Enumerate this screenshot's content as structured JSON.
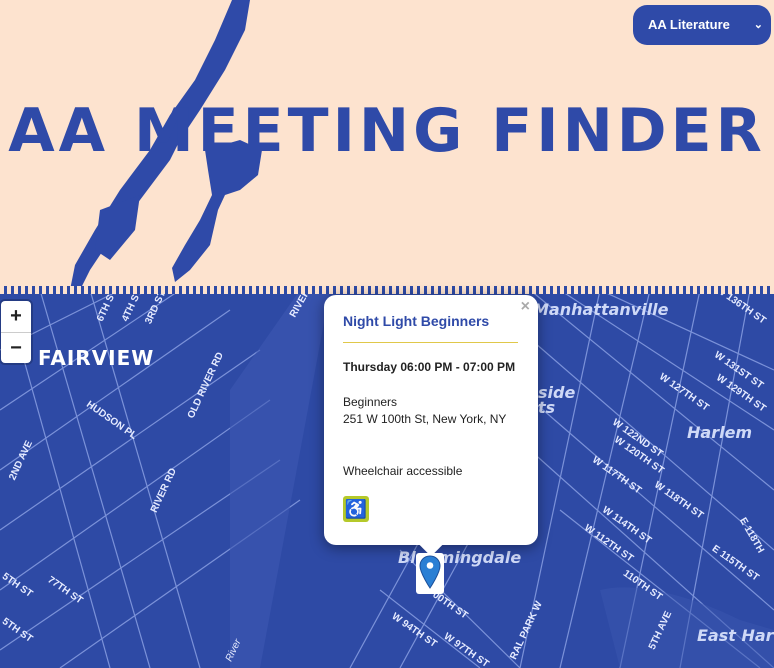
{
  "header": {
    "title": "AA MEETING FINDER",
    "select": {
      "value": "AA Literature"
    }
  },
  "map": {
    "zoom_in": "+",
    "zoom_out": "−",
    "neighborhoods": [
      "FAIRVIEW",
      "Manhattanville",
      "Harlem",
      "Bloomingdale",
      "East Har",
      "side",
      "ts"
    ],
    "streets": [
      "W 136TH ST",
      "W 131ST ST",
      "W 129TH ST",
      "W 127TH ST",
      "W 122ND ST",
      "W 120TH ST",
      "W 117TH ST",
      "W 118TH ST",
      "W 114TH ST",
      "W 112TH ST",
      "E 118TH",
      "E 115TH ST",
      "110TH ST",
      "HUDSON PL",
      "OLD RIVER RD",
      "RIVER RD",
      "2ND AVE",
      "77TH ST",
      "5TH ST",
      "5TH ST",
      "4TH ST",
      "3RD ST",
      "6TH ST",
      "RIVER",
      "W 97TH ST",
      "W 94TH ST",
      "00TH ST",
      "RAL PARK W",
      "5TH AVE",
      "River"
    ]
  },
  "popup": {
    "name": "Night Light Beginners",
    "time": "Thursday 06:00 PM - 07:00 PM",
    "type": "Beginners",
    "address": "251 W 100th St, New York, NY",
    "accessibility": "Wheelchair accessible",
    "close": "×",
    "icon": "wheelchair-icon"
  },
  "colors": {
    "brand_blue": "#2f4aa8",
    "background": "#fde3cf",
    "badge": "#b5c92a"
  }
}
